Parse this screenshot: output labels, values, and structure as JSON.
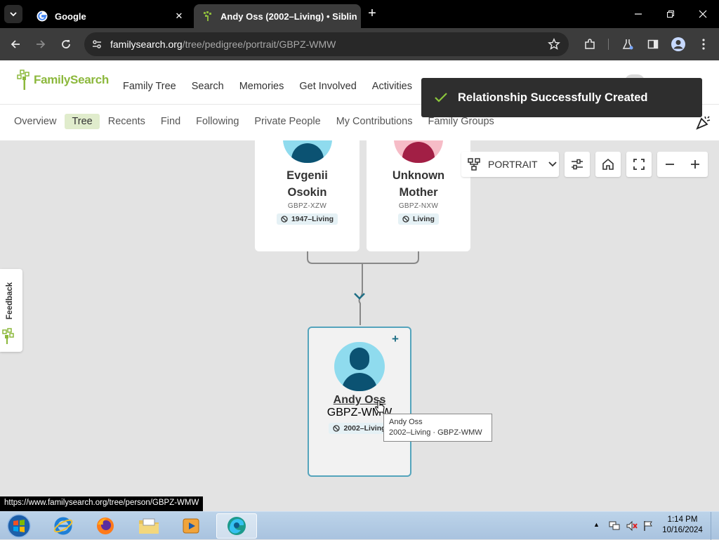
{
  "browser": {
    "tabs": [
      {
        "title": "Google",
        "active": false
      },
      {
        "title": "Andy Oss (2002–Living) • Siblin",
        "active": true
      }
    ],
    "new_tab": "+",
    "url_host": "familysearch.org",
    "url_path": "/tree/pedigree/portrait/GBPZ-WMW"
  },
  "header": {
    "logo_text": "FamilySearch",
    "main_nav": [
      "Family Tree",
      "Search",
      "Memories",
      "Get Involved",
      "Activities"
    ]
  },
  "subnav": {
    "items": [
      "Overview",
      "Tree",
      "Recents",
      "Find",
      "Following",
      "Private People",
      "My Contributions",
      "Family Groups"
    ],
    "active": "Tree"
  },
  "toast": {
    "message": "Relationship Successfully Created"
  },
  "controls": {
    "view_label": "PORTRAIT"
  },
  "feedback_label": "Feedback",
  "people": {
    "father": {
      "name_line1": "Evgenii",
      "name_line2": "Osokin",
      "pid": "GBPZ-XZW",
      "lifespan": "1947–Living"
    },
    "mother": {
      "name_line1": "Unknown",
      "name_line2": "Mother",
      "pid": "GBPZ-NXW",
      "lifespan": "Living"
    },
    "focus": {
      "name": "Andy Oss",
      "pid": "GBPZ-WMW",
      "lifespan": "2002–Living",
      "add": "+"
    }
  },
  "tooltip": {
    "line1": "Andy Oss",
    "line2": "2002–Living · GBPZ-WMW"
  },
  "status_url": "https://www.familysearch.org/tree/person/GBPZ-WMW",
  "taskbar": {
    "time": "1:14 PM",
    "date": "10/16/2024"
  },
  "colors": {
    "brand_green": "#8cb83c",
    "focus_border": "#54a4bc",
    "toast_bg": "#2e2e2e",
    "toast_check": "#8cc83c"
  }
}
